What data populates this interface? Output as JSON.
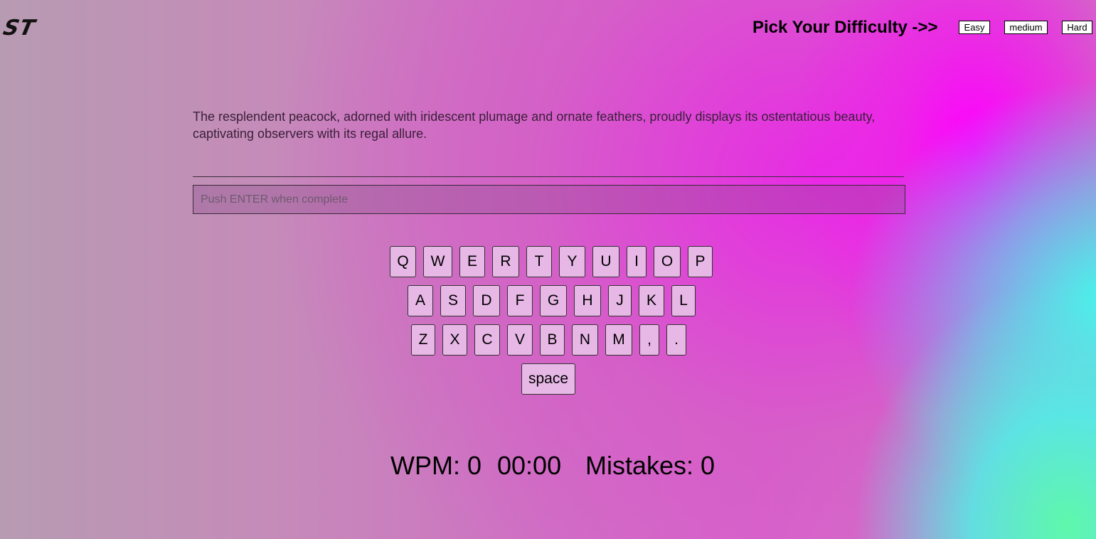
{
  "header": {
    "logo": "ST",
    "difficulty_title": "Pick Your Difficulty ->>",
    "difficulties": [
      "Easy",
      "medium",
      "Hard"
    ]
  },
  "passage": "The resplendent peacock, adorned with iridescent plumage and ornate feathers, proudly displays its ostentatious beauty, captivating observers with its regal allure.",
  "input": {
    "placeholder": "Push ENTER when complete",
    "value": ""
  },
  "keyboard": {
    "rows": [
      [
        "Q",
        "W",
        "E",
        "R",
        "T",
        "Y",
        "U",
        "I",
        "O",
        "P"
      ],
      [
        "A",
        "S",
        "D",
        "F",
        "G",
        "H",
        "J",
        "K",
        "L"
      ],
      [
        "Z",
        "X",
        "C",
        "V",
        "B",
        "N",
        "M",
        ",",
        "."
      ],
      [
        "space"
      ]
    ]
  },
  "stats": {
    "wpm": "WPM: 0",
    "timer": "00:00",
    "mistakes": "Mistakes: 0"
  }
}
